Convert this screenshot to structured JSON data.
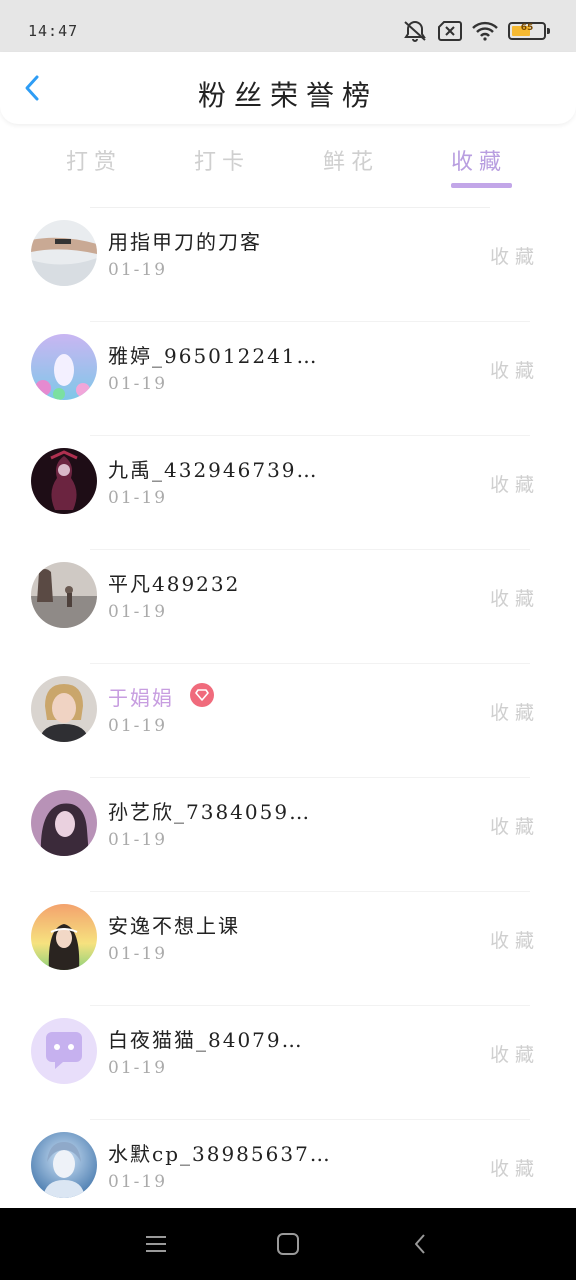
{
  "status_bar": {
    "time": "14:47",
    "battery_level": "65",
    "icons": [
      "mute-icon",
      "sim-none-icon",
      "wifi-icon",
      "battery-icon"
    ]
  },
  "header": {
    "title": "粉丝荣誉榜",
    "back_icon": "chevron-left-icon"
  },
  "tabs": [
    {
      "label": "打赏",
      "active": false
    },
    {
      "label": "打卡",
      "active": false
    },
    {
      "label": "鲜花",
      "active": false
    },
    {
      "label": "收藏",
      "active": true
    }
  ],
  "colors": {
    "accent": "#b89ee0",
    "vip_name": "#c79de0",
    "vip_badge": "#f06b7c",
    "back_arrow": "#2e9df5"
  },
  "fans": [
    {
      "name": "用指甲刀的刀客",
      "date": "01-19",
      "action": "收藏",
      "vip": false
    },
    {
      "name": "雅婷_965012241…",
      "date": "01-19",
      "action": "收藏",
      "vip": false
    },
    {
      "name": "九禹_432946739…",
      "date": "01-19",
      "action": "收藏",
      "vip": false
    },
    {
      "name": "平凡489232",
      "date": "01-19",
      "action": "收藏",
      "vip": false
    },
    {
      "name": "于娟娟",
      "date": "01-19",
      "action": "收藏",
      "vip": true
    },
    {
      "name": "孙艺欣_7384059…",
      "date": "01-19",
      "action": "收藏",
      "vip": false
    },
    {
      "name": "安逸不想上课",
      "date": "01-19",
      "action": "收藏",
      "vip": false
    },
    {
      "name": "白夜猫猫_84079…",
      "date": "01-19",
      "action": "收藏",
      "vip": false
    },
    {
      "name": "水默cp_38985637…",
      "date": "01-19",
      "action": "收藏",
      "vip": false
    }
  ],
  "nav": {
    "menu_icon": "menu-icon",
    "home_icon": "home-square-icon",
    "back_icon": "back-triangle-icon"
  }
}
